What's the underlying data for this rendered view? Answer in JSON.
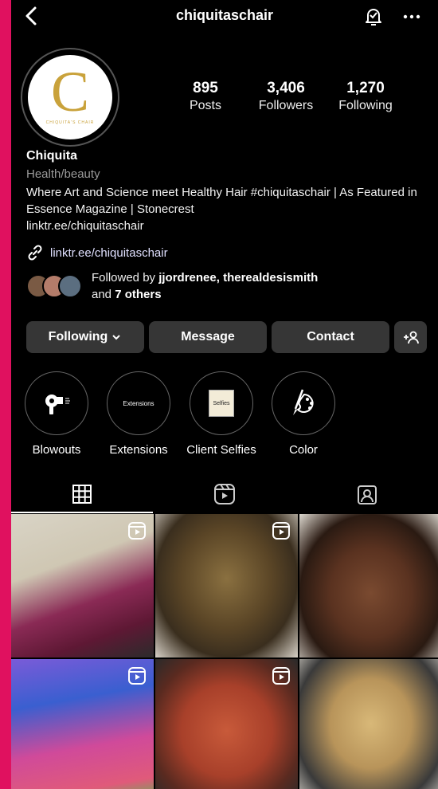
{
  "header": {
    "username": "chiquitaschair"
  },
  "avatar": {
    "logo_letter": "C",
    "logo_text": "CHIQUITA'S CHAIR"
  },
  "stats": [
    {
      "value": "895",
      "label": "Posts"
    },
    {
      "value": "3,406",
      "label": "Followers"
    },
    {
      "value": "1,270",
      "label": "Following"
    }
  ],
  "profile": {
    "name": "Chiquita",
    "category": "Health/beauty",
    "bio": "Where Art and Science meet Healthy Hair #chiquitaschair | As Featured in Essence Magazine | Stonecrest",
    "bio_link": "linktr.ee/chiquitaschair",
    "link": "linktr.ee/chiquitaschair",
    "followed_prefix": "Followed by ",
    "followed_names": "jjordrenee, therealdesismith",
    "followed_and": "and ",
    "followed_others": "7 others"
  },
  "buttons": {
    "following": "Following",
    "message": "Message",
    "contact": "Contact"
  },
  "highlights": [
    {
      "label": "Blowouts",
      "icon": "hair-dryer-icon"
    },
    {
      "label": "Extensions",
      "icon_text": "Extensions"
    },
    {
      "label": "Client Selfies",
      "icon_text": "Selfies"
    },
    {
      "label": "Color",
      "icon": "palette-brush-icon"
    }
  ],
  "tabs": [
    "grid-icon",
    "reels-icon",
    "tagged-icon"
  ],
  "colors": {
    "accent_frame": "#e0115f",
    "button_bg": "#363636",
    "logo_gold": "#c9a23b"
  }
}
